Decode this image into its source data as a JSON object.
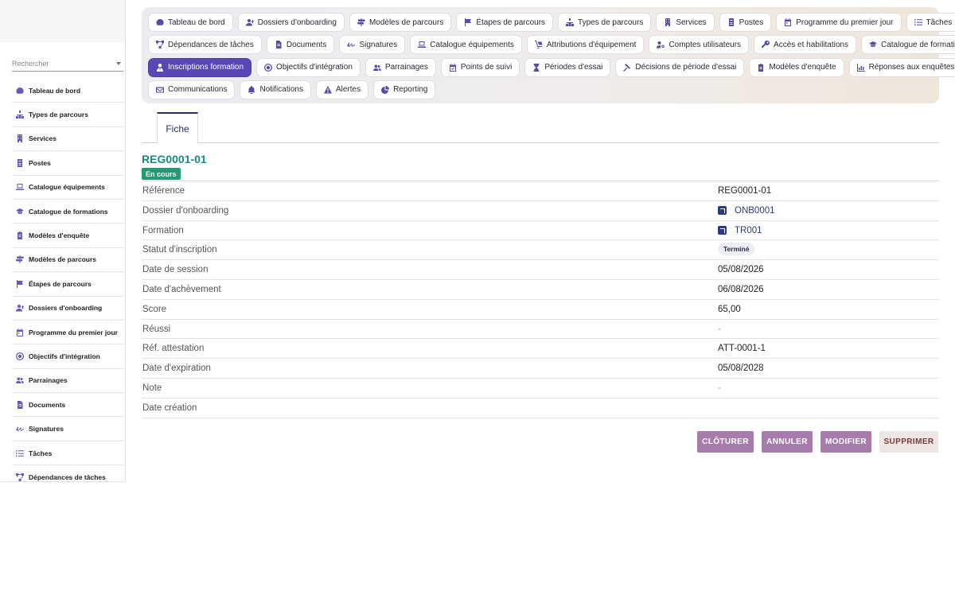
{
  "sidebar": {
    "search_placeholder": "Rechercher",
    "items": [
      {
        "label": "Tableau de bord",
        "icon": "dashboard-icon"
      },
      {
        "label": "Types de parcours",
        "icon": "sitemap-icon"
      },
      {
        "label": "Services",
        "icon": "building-icon"
      },
      {
        "label": "Postes",
        "icon": "badge-icon"
      },
      {
        "label": "Catalogue équipements",
        "icon": "laptop-icon"
      },
      {
        "label": "Catalogue de formations",
        "icon": "graduation-cap-icon"
      },
      {
        "label": "Modèles d'enquête",
        "icon": "clipboard-icon"
      },
      {
        "label": "Modèles de parcours",
        "icon": "signpost-icon"
      },
      {
        "label": "Étapes de parcours",
        "icon": "flag-icon"
      },
      {
        "label": "Dossiers d'onboarding",
        "icon": "user-plus-icon"
      },
      {
        "label": "Programme du premier jour",
        "icon": "calendar-icon"
      },
      {
        "label": "Objectifs d'intégration",
        "icon": "target-icon"
      },
      {
        "label": "Parrainages",
        "icon": "users-icon"
      },
      {
        "label": "Documents",
        "icon": "document-icon"
      },
      {
        "label": "Signatures",
        "icon": "signature-icon"
      },
      {
        "label": "Tâches",
        "icon": "list-icon"
      },
      {
        "label": "Dépendances de tâches",
        "icon": "network-icon"
      }
    ]
  },
  "toolbar": {
    "rows": [
      [
        {
          "label": "Tableau de bord",
          "icon": "dashboard-icon"
        },
        {
          "label": "Dossiers d'onboarding",
          "icon": "user-plus-icon"
        },
        {
          "label": "Modèles de parcours",
          "icon": "signpost-icon"
        },
        {
          "label": "Étapes de parcours",
          "icon": "flag-icon"
        },
        {
          "label": "Types de parcours",
          "icon": "sitemap-icon"
        },
        {
          "label": "Services",
          "icon": "building-icon"
        },
        {
          "label": "Postes",
          "icon": "badge-icon"
        },
        {
          "label": "Programme du premier jour",
          "icon": "calendar-icon"
        },
        {
          "label": "Tâches",
          "icon": "list-icon"
        }
      ],
      [
        {
          "label": "Dépendances de tâches",
          "icon": "network-icon"
        },
        {
          "label": "Documents",
          "icon": "document-icon"
        },
        {
          "label": "Signatures",
          "icon": "signature-icon"
        },
        {
          "label": "Catalogue équipements",
          "icon": "laptop-icon"
        },
        {
          "label": "Attributions d'équipement",
          "icon": "dolly-icon"
        },
        {
          "label": "Comptes utilisateurs",
          "icon": "user-cog-icon"
        },
        {
          "label": "Accès et habilitations",
          "icon": "key-icon"
        },
        {
          "label": "Catalogue de formations",
          "icon": "graduation-cap-icon"
        }
      ],
      [
        {
          "label": "Inscriptions formation",
          "icon": "user-tie-icon",
          "active": true
        },
        {
          "label": "Objectifs d'intégration",
          "icon": "target-icon"
        },
        {
          "label": "Parrainages",
          "icon": "users-icon"
        },
        {
          "label": "Points de suivi",
          "icon": "calendar-check-icon"
        },
        {
          "label": "Périodes d'essai",
          "icon": "hourglass-icon"
        },
        {
          "label": "Décisions de période d'essai",
          "icon": "gavel-icon"
        },
        {
          "label": "Modèles d'enquête",
          "icon": "clipboard-icon"
        },
        {
          "label": "Réponses aux enquêtes",
          "icon": "chart-icon"
        }
      ],
      [
        {
          "label": "Communications",
          "icon": "envelope-icon"
        },
        {
          "label": "Notifications",
          "icon": "bell-icon"
        },
        {
          "label": "Alertes",
          "icon": "warning-icon"
        },
        {
          "label": "Reporting",
          "icon": "pie-chart-icon"
        }
      ]
    ]
  },
  "tab": {
    "label": "Fiche"
  },
  "record": {
    "title": "REG0001-01",
    "status": "En cours",
    "status_color": "#239a74"
  },
  "fields": [
    {
      "label": "Référence",
      "value": "REG0001-01",
      "kind": "text"
    },
    {
      "label": "Dossier d'onboarding",
      "value": "ONB0001",
      "kind": "link"
    },
    {
      "label": "Formation",
      "value": "TR001",
      "kind": "link"
    },
    {
      "label": "Statut d'inscription",
      "value": "Terminé",
      "kind": "pill"
    },
    {
      "label": "Date de session",
      "value": "05/08/2026",
      "kind": "text"
    },
    {
      "label": "Date d'achèvement",
      "value": "06/08/2026",
      "kind": "text"
    },
    {
      "label": "Score",
      "value": "65,00",
      "kind": "text"
    },
    {
      "label": "Réussi",
      "value": "-",
      "kind": "muted"
    },
    {
      "label": "Réf. attestation",
      "value": "ATT-0001-1",
      "kind": "text"
    },
    {
      "label": "Date d'expiration",
      "value": "05/08/2028",
      "kind": "text"
    },
    {
      "label": "Note",
      "value": "-",
      "kind": "muted"
    },
    {
      "label": "Date création",
      "value": "",
      "kind": "text"
    }
  ],
  "actions": {
    "close_label": "CLÔTURER",
    "cancel_label": "ANNULER",
    "edit_label": "MODIFIER",
    "delete_label": "SUPPRIMER"
  },
  "colors": {
    "accent": "#5848b6",
    "title": "#1d8a82",
    "primary_button": "#a77bab"
  }
}
